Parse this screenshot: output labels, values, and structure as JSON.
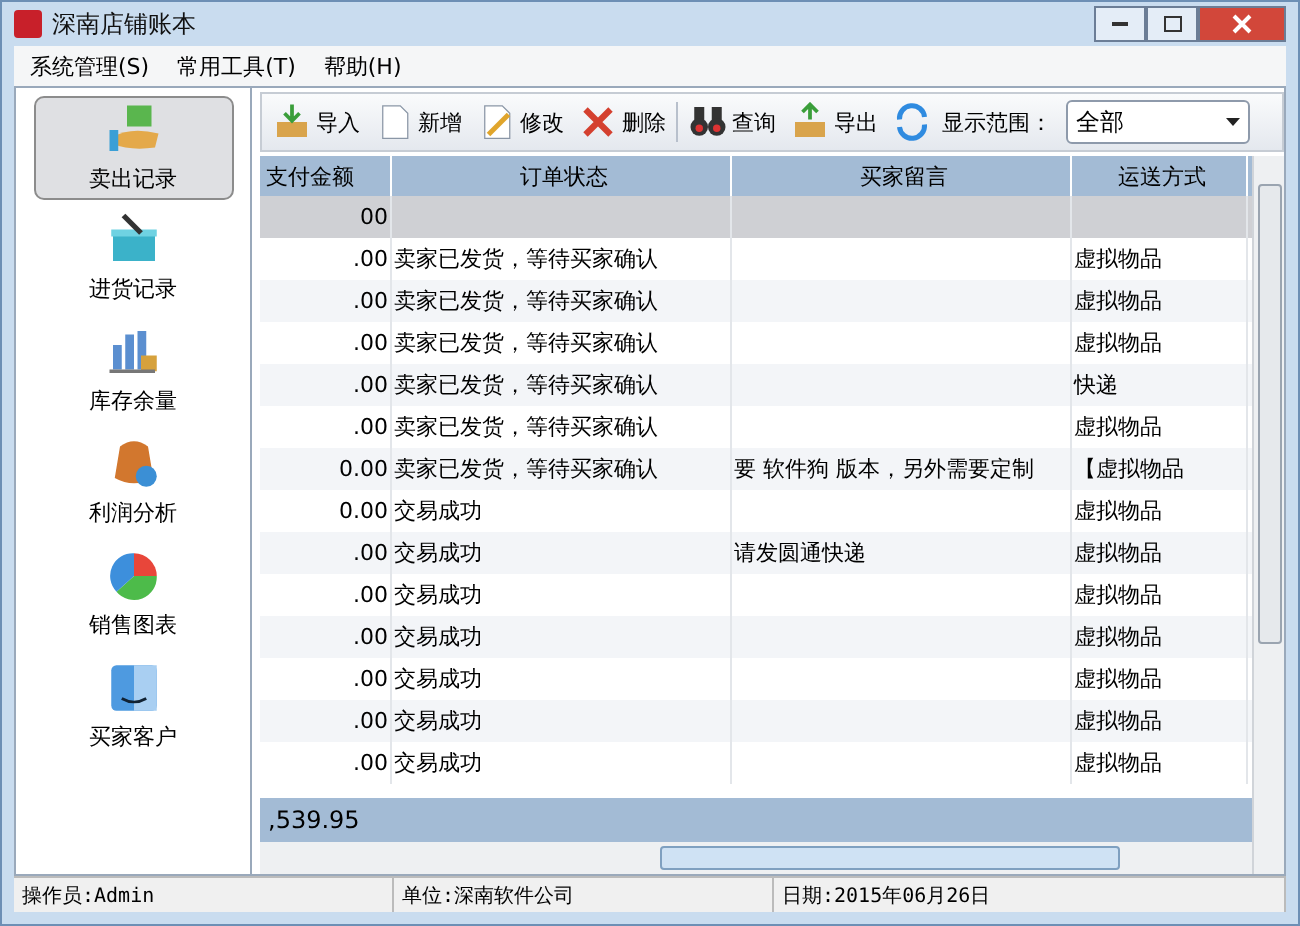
{
  "window": {
    "title": "深南店铺账本"
  },
  "menu": [
    "系统管理(S)",
    "常用工具(T)",
    "帮助(H)"
  ],
  "sidebar": {
    "items": [
      {
        "label": "卖出记录",
        "selected": true
      },
      {
        "label": "进货记录",
        "selected": false
      },
      {
        "label": "库存余量",
        "selected": false
      },
      {
        "label": "利润分析",
        "selected": false
      },
      {
        "label": "销售图表",
        "selected": false
      },
      {
        "label": "买家客户",
        "selected": false
      }
    ]
  },
  "toolbar": {
    "buttons": [
      "导入",
      "新增",
      "修改",
      "删除",
      "查询",
      "导出"
    ],
    "range_label": "显示范围：",
    "range_value": "全部"
  },
  "table": {
    "columns": [
      "支付金额",
      "订单状态",
      "买家留言",
      "运送方式"
    ],
    "rows": [
      {
        "cells": [
          "00",
          "",
          "",
          ""
        ],
        "selected": true
      },
      {
        "cells": [
          ".00",
          "卖家已发货，等待买家确认",
          "",
          "虚拟物品"
        ],
        "selected": false
      },
      {
        "cells": [
          ".00",
          "卖家已发货，等待买家确认",
          "",
          "虚拟物品"
        ],
        "selected": false
      },
      {
        "cells": [
          ".00",
          "卖家已发货，等待买家确认",
          "",
          "虚拟物品"
        ],
        "selected": false
      },
      {
        "cells": [
          ".00",
          "卖家已发货，等待买家确认",
          "",
          "快递"
        ],
        "selected": false
      },
      {
        "cells": [
          ".00",
          "卖家已发货，等待买家确认",
          "",
          "虚拟物品"
        ],
        "selected": false
      },
      {
        "cells": [
          "0.00",
          "卖家已发货，等待买家确认",
          "要 软件狗  版本，另外需要定制",
          "【虚拟物品"
        ],
        "selected": false
      },
      {
        "cells": [
          "0.00",
          "交易成功",
          "",
          "虚拟物品"
        ],
        "selected": false
      },
      {
        "cells": [
          ".00",
          "交易成功",
          "请发圆通快递",
          "虚拟物品"
        ],
        "selected": false
      },
      {
        "cells": [
          ".00",
          "交易成功",
          "",
          "虚拟物品"
        ],
        "selected": false
      },
      {
        "cells": [
          ".00",
          "交易成功",
          "",
          "虚拟物品"
        ],
        "selected": false
      },
      {
        "cells": [
          ".00",
          "交易成功",
          "",
          "虚拟物品"
        ],
        "selected": false
      },
      {
        "cells": [
          ".00",
          "交易成功",
          "",
          "虚拟物品"
        ],
        "selected": false
      },
      {
        "cells": [
          ".00",
          "交易成功",
          "",
          "虚拟物品"
        ],
        "selected": false
      }
    ],
    "total": ",539.95"
  },
  "status_bar": [
    "操作员:Admin",
    "单位:深南软件公司",
    "日期:2015年06月26日"
  ]
}
